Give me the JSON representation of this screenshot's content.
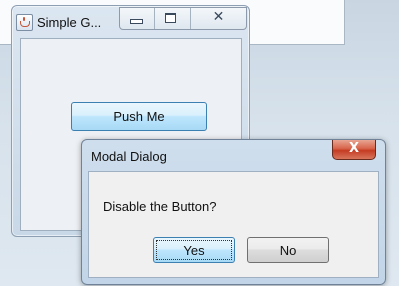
{
  "main_window": {
    "title": "Simple G...",
    "content": {
      "push_button_label": "Push Me"
    }
  },
  "dialog": {
    "title": "Modal Dialog",
    "close_glyph": "X",
    "message": "Disable the Button?",
    "yes_label": "Yes",
    "no_label": "No"
  },
  "icons": {
    "app": "java-cup-icon",
    "minimize": "minimize-icon",
    "maximize": "maximize-icon",
    "close": "close-icon"
  },
  "colors": {
    "desktop": "#d7e2ec",
    "frame": "#cfdeed",
    "button_hover": "#bee6fd",
    "close_red": "#c43c22"
  }
}
